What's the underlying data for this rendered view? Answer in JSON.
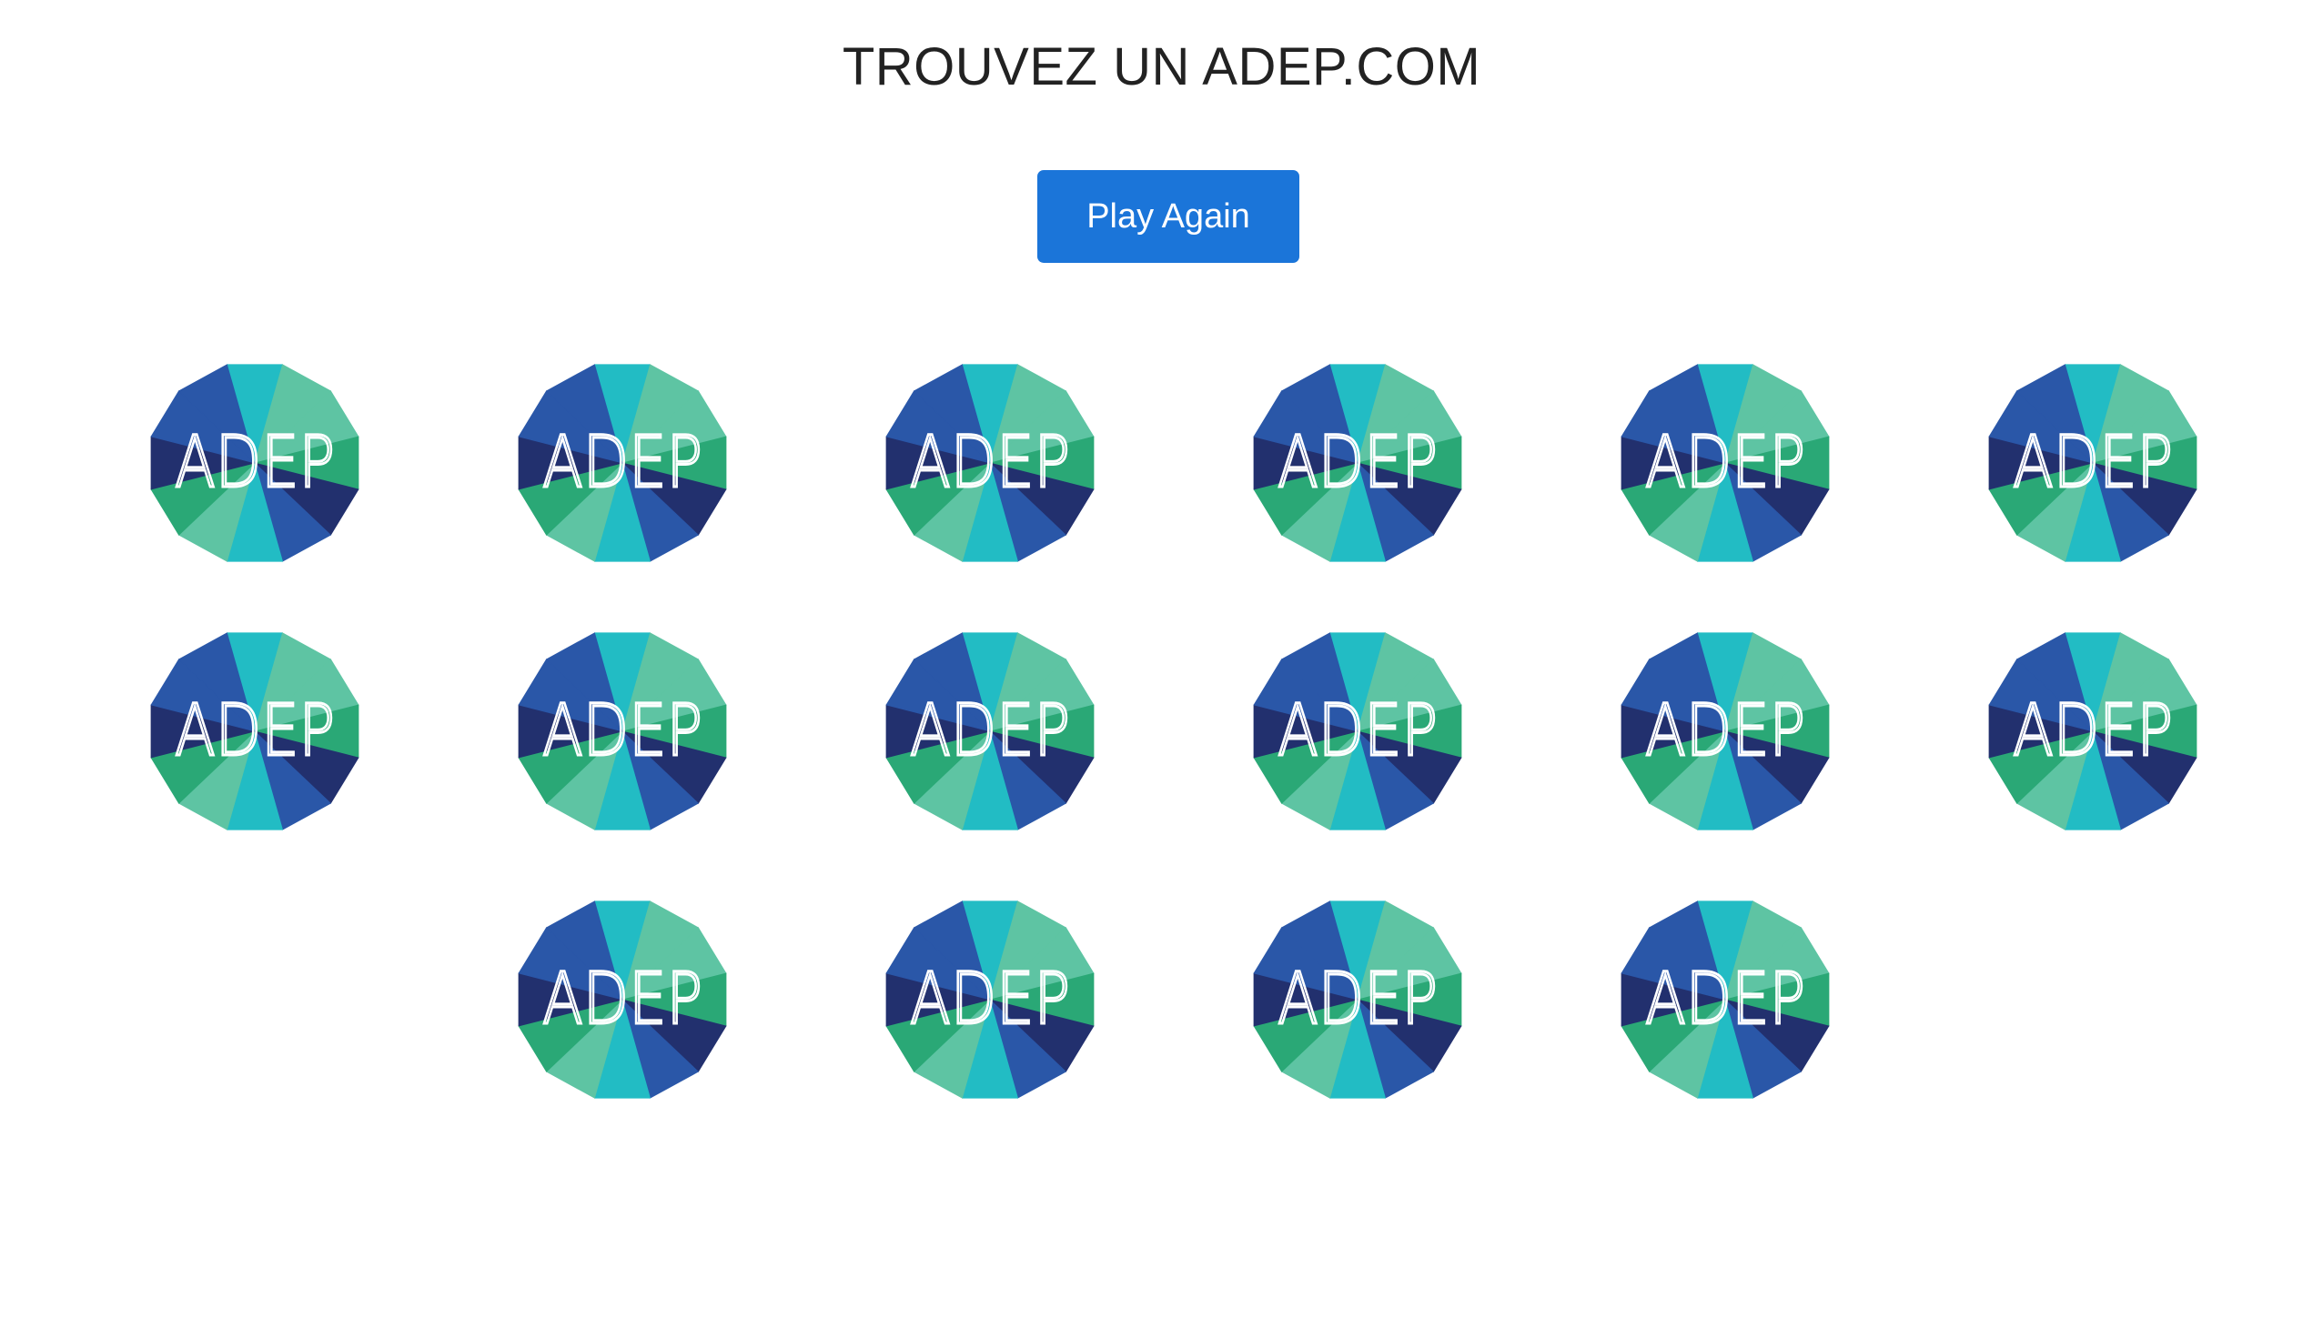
{
  "title": "TROUVEZ UN ADEP.COM",
  "play_again_label": "Play Again",
  "card_logo_text": "ADEP",
  "card_icon": "adep-logo-icon",
  "card_count": 16,
  "colors": {
    "button": "#1b75d9",
    "title": "#222222",
    "logo_navy": "#22306e",
    "logo_blue": "#2a57a8",
    "logo_teal": "#22bcc4",
    "logo_mint": "#5ec4a3",
    "logo_green": "#2aa876"
  }
}
